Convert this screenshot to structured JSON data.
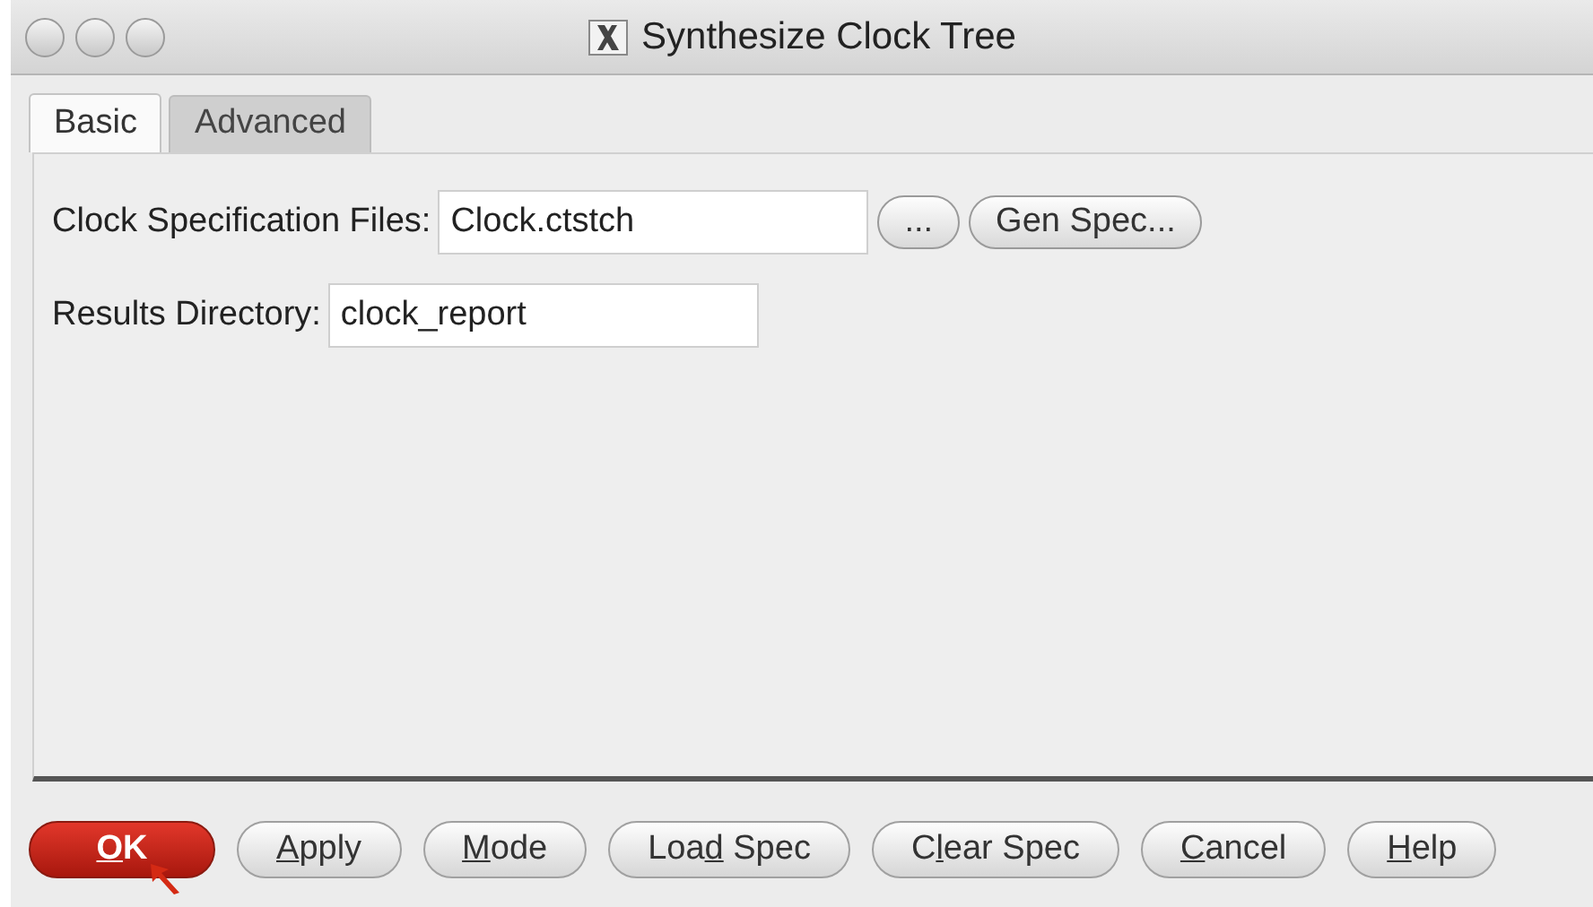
{
  "window": {
    "title": "Synthesize Clock Tree"
  },
  "tabs": [
    {
      "label": "Basic",
      "selected": true
    },
    {
      "label": "Advanced",
      "selected": false
    }
  ],
  "fields": [
    {
      "label": "Clock Specification Files:",
      "value": "Clock.ctstch",
      "buttons": [
        "...",
        "Gen Spec..."
      ]
    },
    {
      "label": "Results Directory:",
      "value": "clock_report"
    }
  ],
  "buttons": [
    {
      "key": "O",
      "post": "K",
      "default": true
    },
    {
      "key": "A",
      "post": "pply",
      "default": false
    },
    {
      "key": "M",
      "post": "ode",
      "default": false
    },
    {
      "pre": "Loa",
      "key": "d",
      "post": " Spec",
      "default": false
    },
    {
      "pre": "C",
      "key": "l",
      "post": "ear Spec",
      "default": false
    },
    {
      "key": "C",
      "post": "ancel",
      "default": false
    },
    {
      "key": "H",
      "post": "elp",
      "default": false
    }
  ]
}
